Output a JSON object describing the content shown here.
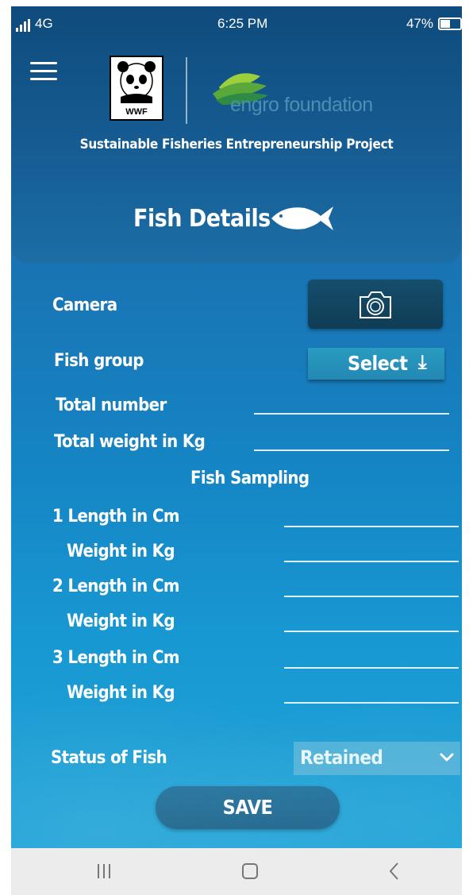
{
  "status_bar": {
    "network": "4G",
    "time": "6:25 PM",
    "battery": "47%"
  },
  "header": {
    "wwf_label": "WWF",
    "engro_label": "engro foundation",
    "project_title": "Sustainable Fisheries Entrepreneurship Project",
    "page_title": "Fish Details"
  },
  "form": {
    "camera_label": "Camera",
    "fish_group_label": "Fish group",
    "fish_group_button": "Select",
    "fish_group_arrow": "⤓",
    "total_number_label": "Total number",
    "total_weight_label": "Total weight in Kg",
    "sampling_title": "Fish Sampling",
    "samples": [
      {
        "length_label": "1 Length in Cm",
        "weight_label": "Weight in Kg"
      },
      {
        "length_label": "2 Length in Cm",
        "weight_label": "Weight in Kg"
      },
      {
        "length_label": "3 Length in Cm",
        "weight_label": "Weight in Kg"
      }
    ],
    "status_label": "Status of Fish",
    "status_value": "Retained",
    "save_label": "SAVE"
  },
  "icons": {
    "menu": "hamburger-icon",
    "camera": "camera-icon",
    "fish": "fish-icon",
    "dropdown": "chevron-down-icon",
    "nav_recents": "recents-icon",
    "nav_home": "home-icon",
    "nav_back": "back-icon"
  },
  "colors": {
    "background_top": "#1a5f97",
    "background_bottom": "#1ea3d7",
    "header": "#165e95",
    "select_button": "#2a9bc1",
    "dropdown": "#4fb1d8",
    "save_button": "#1c6f9b",
    "camera_button": "#154e6c"
  }
}
